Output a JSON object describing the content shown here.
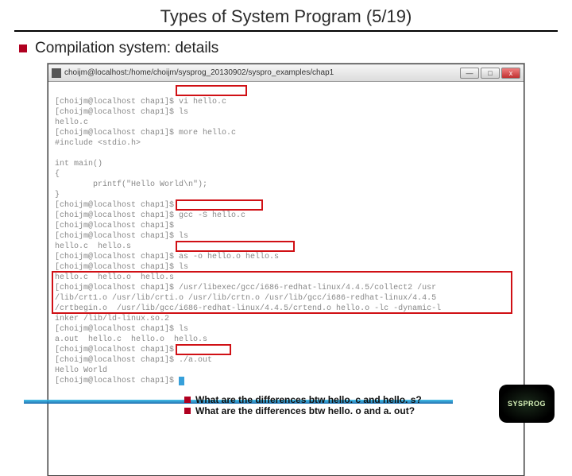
{
  "title": "Types of System Program (5/19)",
  "bullet": "Compilation system: details",
  "window": {
    "title": "choijm@localhost:/home/choijm/sysprog_20130902/syspro_examples/chap1",
    "buttons": {
      "min": "—",
      "max": "□",
      "close": "x"
    }
  },
  "term": {
    "l01": "[choijm@localhost chap1]$ vi hello.c",
    "l02": "[choijm@localhost chap1]$ ls",
    "l03": "hello.c",
    "l04": "[choijm@localhost chap1]$ more hello.c",
    "l05": "#include <stdio.h>",
    "l06": "",
    "l07": "int main()",
    "l08": "{",
    "l09": "        printf(\"Hello World\\n\");",
    "l10": "}",
    "l11": "[choijm@localhost chap1]$",
    "l12": "[choijm@localhost chap1]$ gcc -S hello.c",
    "l13": "[choijm@localhost chap1]$",
    "l14": "[choijm@localhost chap1]$ ls",
    "l15": "hello.c  hello.s",
    "l16": "[choijm@localhost chap1]$ as -o hello.o hello.s",
    "l17": "[choijm@localhost chap1]$ ls",
    "l18": "hello.c  hello.o  hello.s",
    "l19": "[choijm@localhost chap1]$ /usr/libexec/gcc/i686-redhat-linux/4.4.5/collect2 /usr",
    "l20": "/lib/crt1.o /usr/lib/crti.o /usr/lib/crtn.o /usr/lib/gcc/i686-redhat-linux/4.4.5",
    "l21": "/crtbegin.o  /usr/lib/gcc/i686-redhat-linux/4.4.5/crtend.o hello.o -lc -dynamic-l",
    "l22": "inker /lib/ld-linux.so.2",
    "l23": "[choijm@localhost chap1]$ ls",
    "l24": "a.out  hello.c  hello.o  hello.s",
    "l25": "[choijm@localhost chap1]$",
    "l26": "[choijm@localhost chap1]$ ./a.out",
    "l27": "Hello World",
    "l28": "[choijm@localhost chap1]$ "
  },
  "questions": {
    "q1": "What are the differences btw hello. c and hello. s?",
    "q2": "What are the differences btw hello. o and a. out?"
  },
  "badge": "SYSPROG"
}
